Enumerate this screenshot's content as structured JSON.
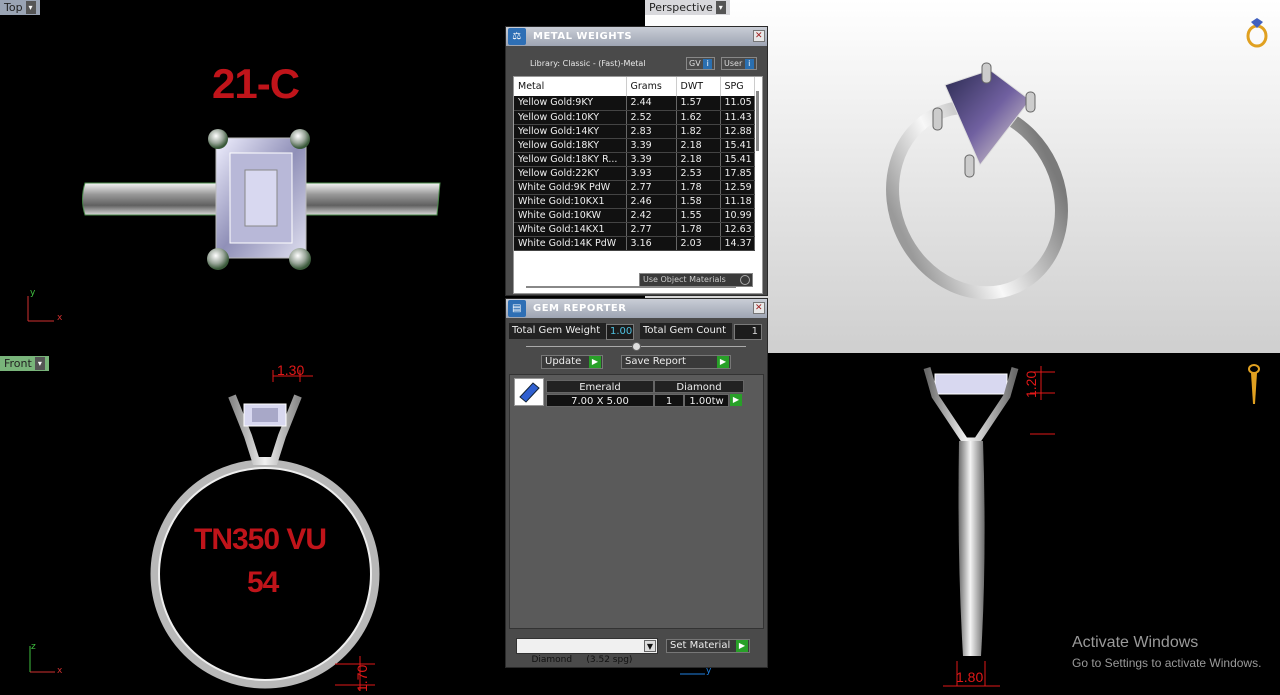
{
  "viewports": {
    "top": {
      "label": "Top",
      "annotation": "21-C",
      "axis_x": "x",
      "axis_y": "y"
    },
    "perspective": {
      "label": "Perspective"
    },
    "front": {
      "label": "Front",
      "line1": "TN350 VU",
      "line2": "54",
      "dim_top": "1.30",
      "dim_bottom": "1.70",
      "axis_x": "x",
      "axis_z": "z"
    },
    "right": {
      "dim_side": "1.20",
      "dim_bottom": "1.80",
      "axis_y": "y"
    }
  },
  "metal_weights": {
    "title": "METAL WEIGHTS",
    "library": "Library: Classic - (Fast)-Metal",
    "gv_label": "GV",
    "user_label": "User",
    "columns": [
      "Metal",
      "Grams",
      "DWT",
      "SPG"
    ],
    "rows": [
      [
        "Yellow Gold:9KY",
        "2.44",
        "1.57",
        "11.05"
      ],
      [
        "Yellow Gold:10KY",
        "2.52",
        "1.62",
        "11.43"
      ],
      [
        "Yellow Gold:14KY",
        "2.83",
        "1.82",
        "12.88"
      ],
      [
        "Yellow Gold:18KY",
        "3.39",
        "2.18",
        "15.41"
      ],
      [
        "Yellow Gold:18KY R...",
        "3.39",
        "2.18",
        "15.41"
      ],
      [
        "Yellow Gold:22KY",
        "3.93",
        "2.53",
        "17.85"
      ],
      [
        "White Gold:9K PdW",
        "2.77",
        "1.78",
        "12.59"
      ],
      [
        "White Gold:10KX1",
        "2.46",
        "1.58",
        "11.18"
      ],
      [
        "White Gold:10KW",
        "2.42",
        "1.55",
        "10.99"
      ],
      [
        "White Gold:14KX1",
        "2.77",
        "1.78",
        "12.63"
      ],
      [
        "White Gold:14K PdW",
        "3.16",
        "2.03",
        "14.37"
      ]
    ],
    "use_object_materials": "Use Object Materials"
  },
  "gem_reporter": {
    "title": "GEM REPORTER",
    "total_weight_label": "Total Gem Weight",
    "total_weight_value": "1.00",
    "total_count_label": "Total Gem Count",
    "total_count_value": "1",
    "update_label": "Update",
    "save_report_label": "Save Report",
    "gem_shape": "Emerald",
    "gem_type": "Diamond",
    "gem_size": "7.00 X 5.00",
    "gem_qty": "1",
    "gem_weight": "1.00tw",
    "material_select": "Diamond     (3.52 spg)",
    "set_material_label": "Set Material"
  },
  "watermark": {
    "title": "Activate Windows",
    "subtitle": "Go to Settings to activate Windows."
  },
  "colors": {
    "dim_red": "#e01818",
    "label_red": "#c0141a",
    "panel_bg": "#4a4a4a"
  }
}
